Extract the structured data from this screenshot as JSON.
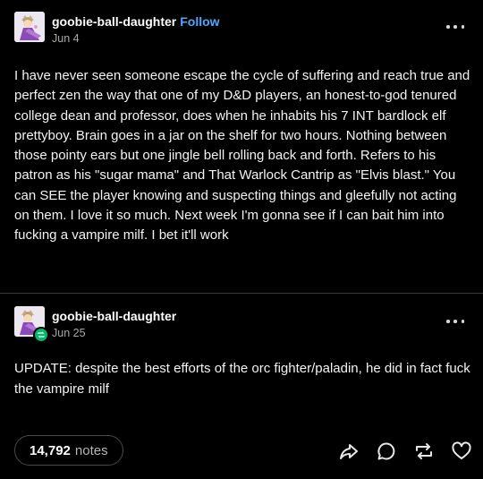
{
  "post": {
    "author": "goobie-ball-daughter",
    "follow_label": "Follow",
    "date": "Jun 4",
    "body": "I have never seen someone escape the cycle of suffering and reach true and perfect zen the way that one of my D&D players, an honest-to-god tenured college dean and professor, does when he inhabits his 7 INT bardlock elf prettyboy. Brain goes in a jar on the shelf for two hours. Nothing between those pointy ears but one jingle bell rolling back and forth. Refers to his patron as his \"sugar mama\" and That Warlock Cantrip as \"Elvis blast.\" You can SEE the player knowing and suspecting things and gleefully not acting on them. I love it so much. Next week I'm gonna see if I can bait him into fucking a vampire milf. I bet it'll work"
  },
  "reblog": {
    "author": "goobie-ball-daughter",
    "date": "Jun 25",
    "body": "UPDATE: despite the best efforts of the orc fighter/paladin, he did in fact fuck the vampire milf"
  },
  "footer": {
    "notes_count": "14,792",
    "notes_word": "notes",
    "actions": [
      "share-icon",
      "reply-icon",
      "reblog-icon",
      "like-icon"
    ]
  },
  "colors": {
    "background": "#000000",
    "text": "#f2f2f2",
    "follow": "#4aa8ff",
    "reblog_badge": "#00b86b",
    "muted": "#a8a8a8"
  }
}
